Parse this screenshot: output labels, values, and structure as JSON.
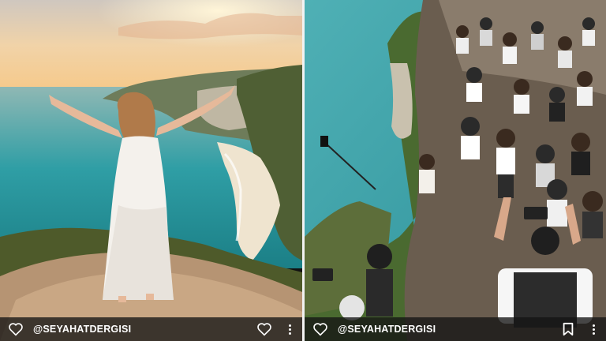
{
  "left_post": {
    "photo": "woman in white dress with raised arms on a cliff above a turquoise bay at sunset",
    "handle": "@SEYAHATDERGISI",
    "icons": {
      "like": "heart-icon",
      "action": "heart-icon",
      "more": "more-dots-icon"
    }
  },
  "right_post": {
    "photo": "crowd of tourists taking selfies and photos on the same cliff edge",
    "handle": "@SEYAHATDERGISI",
    "icons": {
      "like": "heart-icon",
      "action": "bookmark-icon",
      "more": "more-dots-icon"
    }
  },
  "colors": {
    "bar": "#141414",
    "icon": "#ffffff",
    "sea": "#2aa6ad",
    "sky": "#f3c48f"
  }
}
